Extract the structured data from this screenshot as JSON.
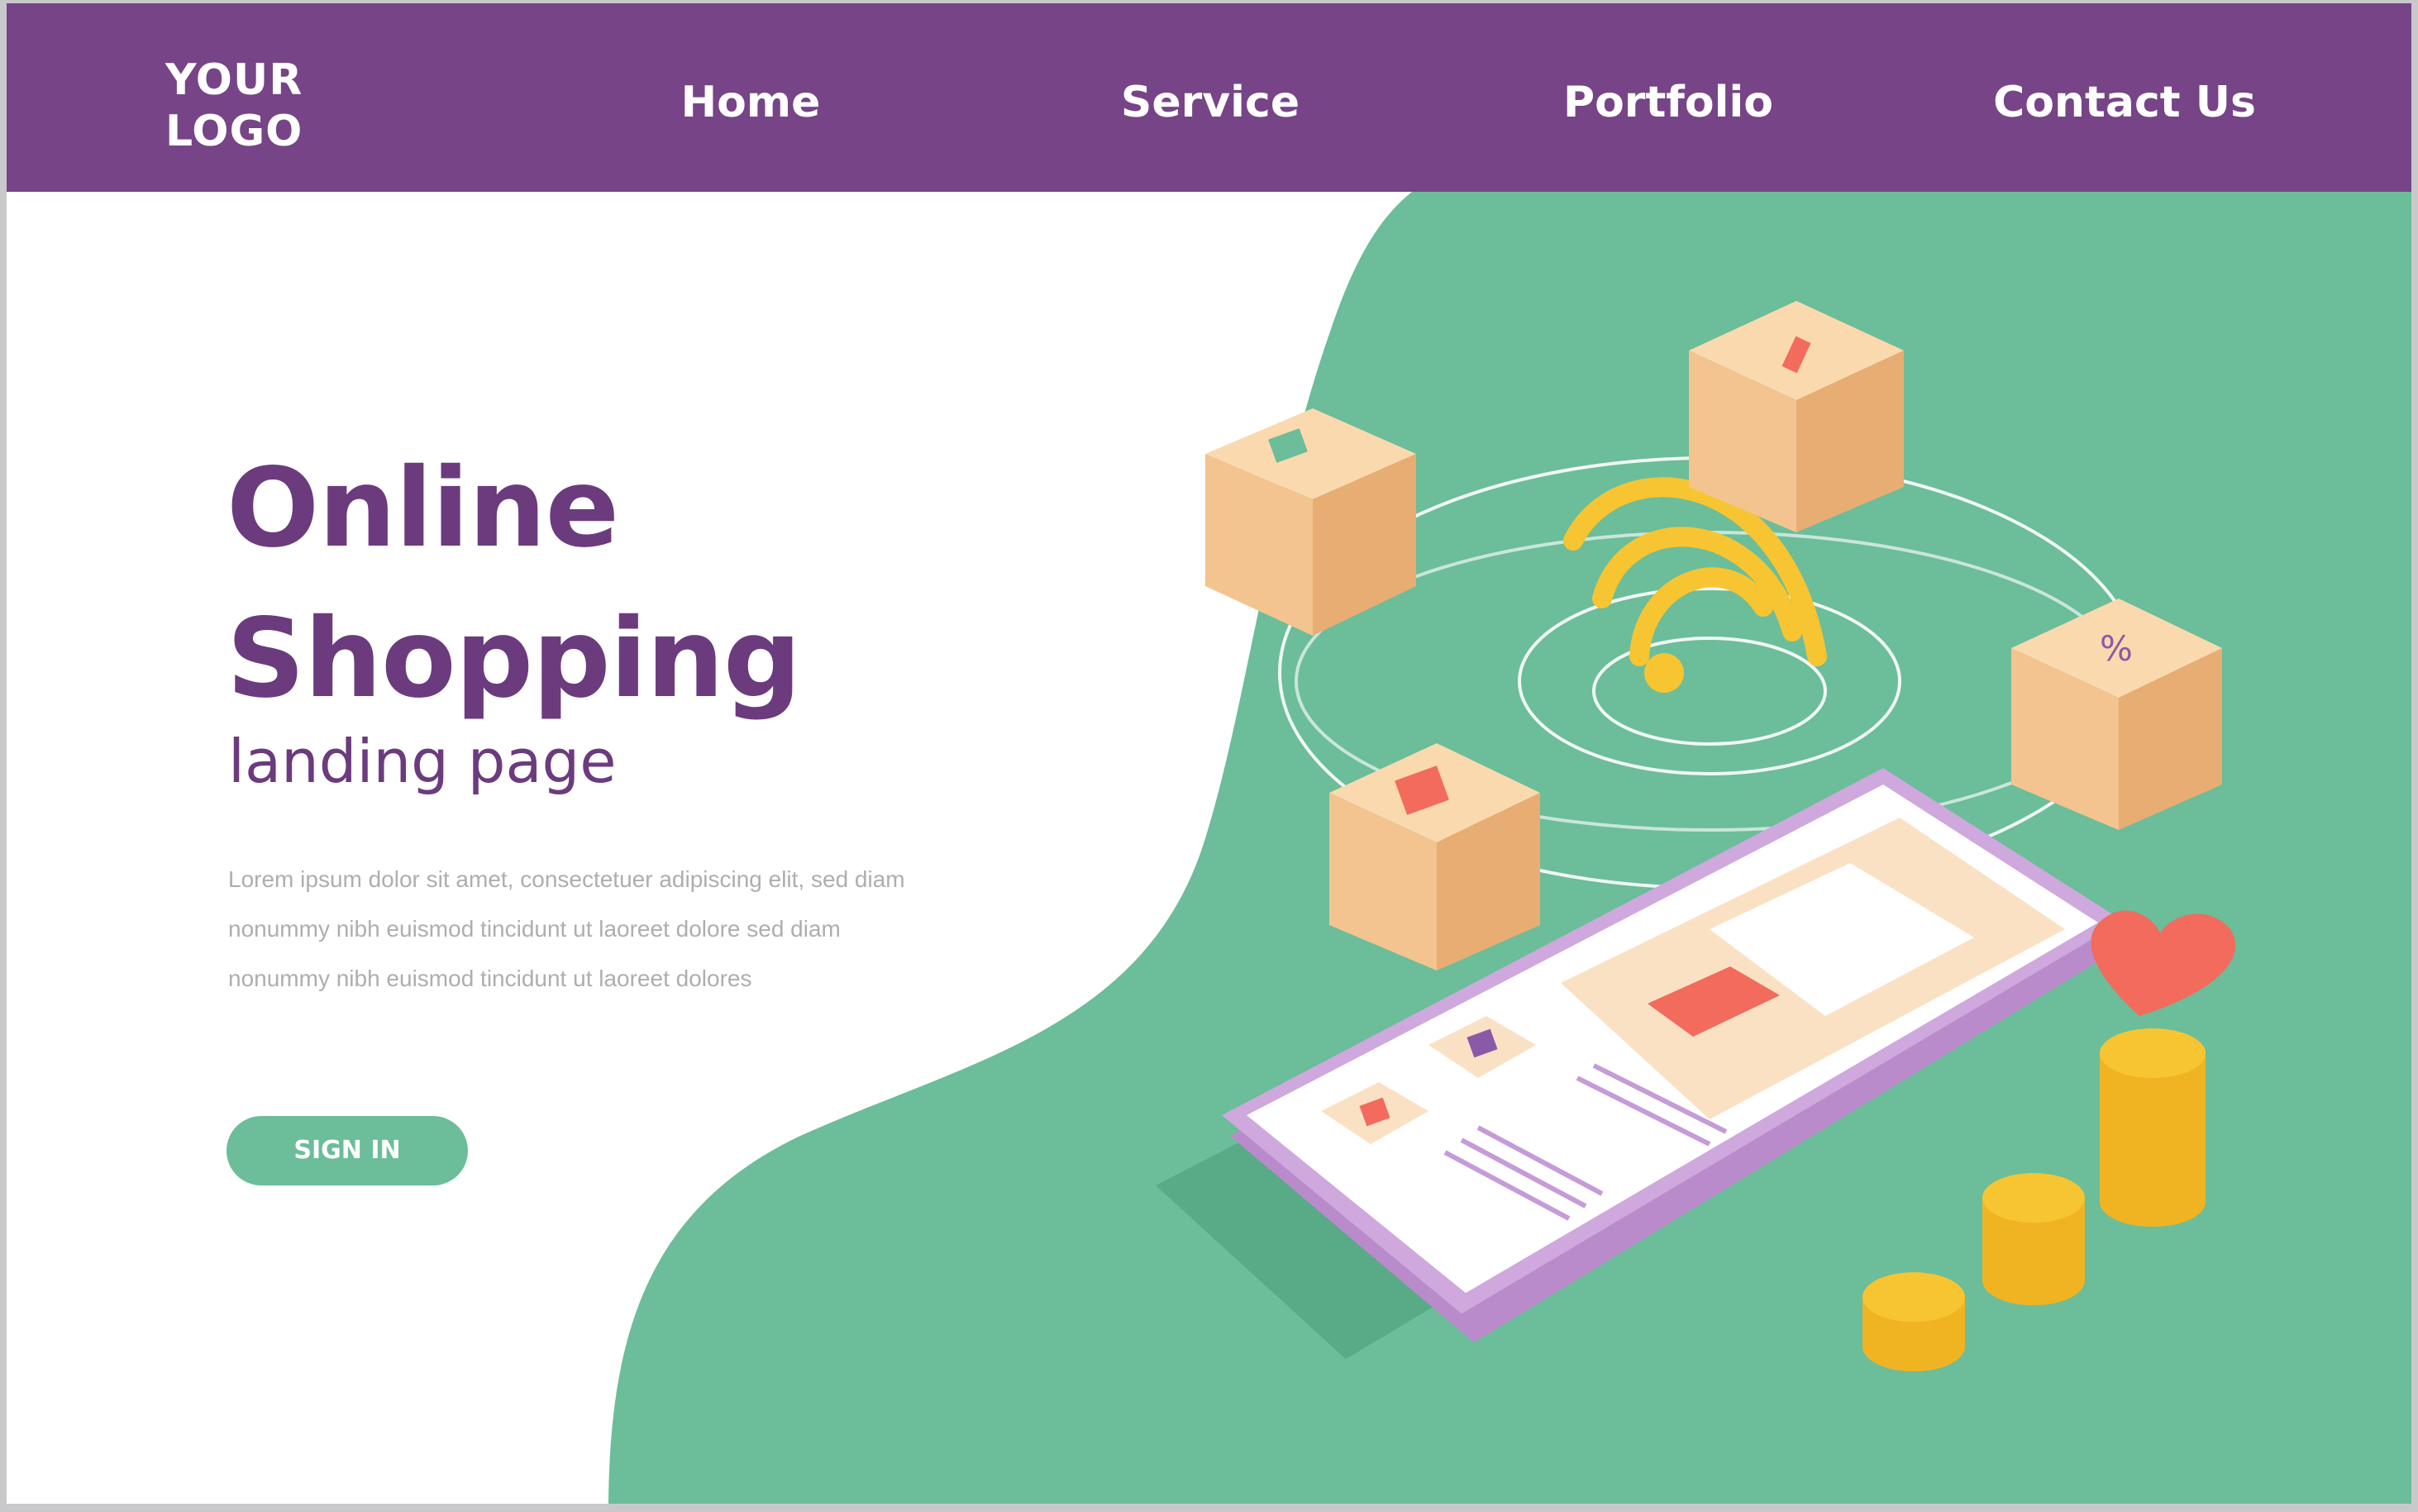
{
  "header": {
    "logo": "YOUR\nLOGO",
    "nav": [
      "Home",
      "Service",
      "Portfolio",
      "Contact Us"
    ]
  },
  "hero": {
    "title": "Online\nShopping",
    "subtitle": "landing page",
    "body": "Lorem ipsum dolor sit amet, consectetuer adipiscing elit, sed diam nonummy nibh euismod tincidunt ut laoreet dolore sed diam nonummy nibh euismod tincidunt ut laoreet dolores",
    "cta": "SIGN IN"
  },
  "illustration": {
    "box_icons": [
      "%"
    ]
  },
  "colors": {
    "header": "#774487",
    "accent_green": "#6cbd9a",
    "title_purple": "#6b3b7e",
    "box": "#f3c48f",
    "coin": "#f7c531",
    "heart": "#f26b5c"
  }
}
